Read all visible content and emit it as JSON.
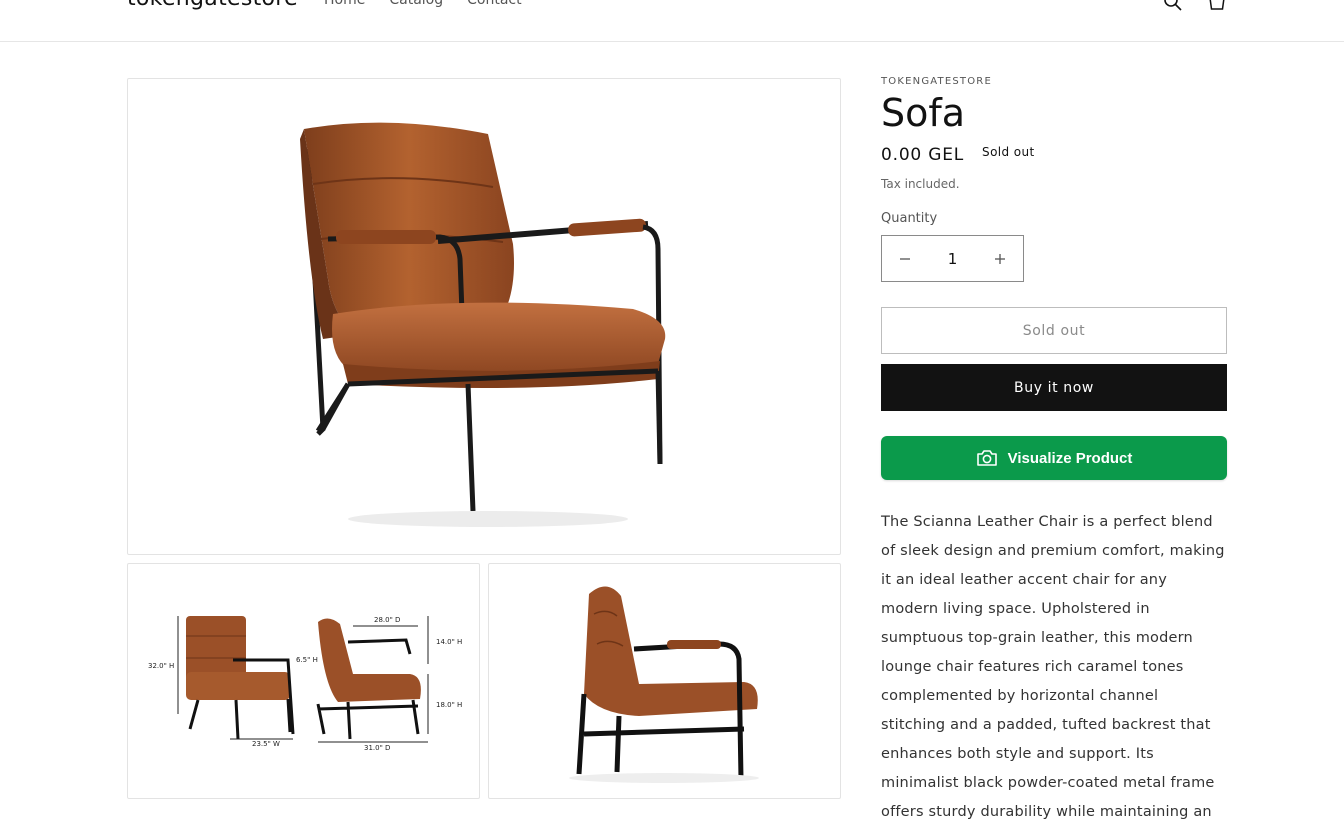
{
  "header": {
    "logo": "tokengatestore",
    "nav": [
      "Home",
      "Catalog",
      "Contact"
    ],
    "icons": [
      "search-icon",
      "cart-icon"
    ]
  },
  "product": {
    "vendor": "TOKENGATESTORE",
    "title": "Sofa",
    "price": "0.00 GEL",
    "badge": "Sold out",
    "tax_note": "Tax included.",
    "quantity_label": "Quantity",
    "quantity_value": "1",
    "sold_out_button": "Sold out",
    "buy_now_button": "Buy it now",
    "visualize_button": "Visualize Product",
    "description": "The Scianna Leather Chair is a perfect blend of sleek design and premium comfort, making it an ideal leather accent chair for any modern living space. Upholstered in sumptuous top-grain leather, this modern lounge chair features rich caramel tones complemented by horizontal channel stitching and a padded, tufted backrest that enhances both style and support. Its minimalist black powder-coated metal frame offers sturdy durability while maintaining an"
  },
  "gallery": {
    "dimension_labels": [
      "32.0\" H",
      "6.5\" H",
      "23.5\" W",
      "28.0\" D",
      "14.0\" H",
      "18.0\" H",
      "31.0\" D"
    ]
  },
  "colors": {
    "accent_green": "#0b9a4b",
    "button_dark": "#121212",
    "leather": "#a9592c"
  }
}
